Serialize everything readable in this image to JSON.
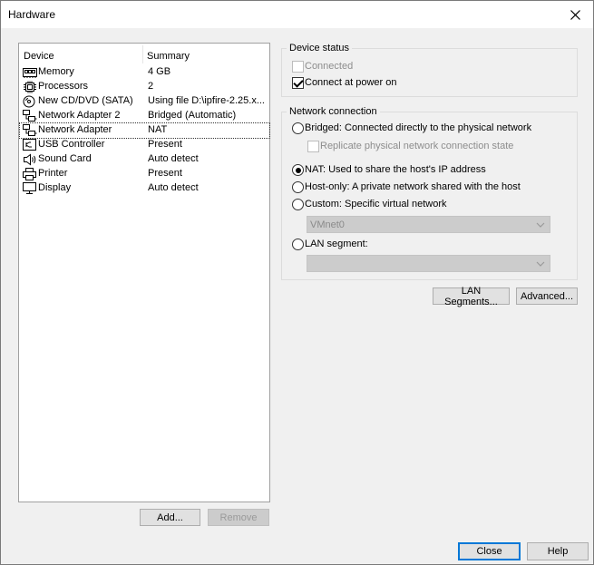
{
  "window": {
    "title": "Hardware"
  },
  "device_list": {
    "columns": [
      "Device",
      "Summary"
    ],
    "rows": [
      {
        "device": "Memory",
        "summary": "4 GB",
        "icon": "memory-icon"
      },
      {
        "device": "Processors",
        "summary": "2",
        "icon": "processor-icon"
      },
      {
        "device": "New CD/DVD (SATA)",
        "summary": "Using file D:\\ipfire-2.25.x...",
        "icon": "cd-dvd-icon"
      },
      {
        "device": "Network Adapter 2",
        "summary": "Bridged (Automatic)",
        "icon": "network-adapter-icon"
      },
      {
        "device": "Network Adapter",
        "summary": "NAT",
        "icon": "network-adapter-icon",
        "selected": true
      },
      {
        "device": "USB Controller",
        "summary": "Present",
        "icon": "usb-icon"
      },
      {
        "device": "Sound Card",
        "summary": "Auto detect",
        "icon": "speaker-icon"
      },
      {
        "device": "Printer",
        "summary": "Present",
        "icon": "printer-icon"
      },
      {
        "device": "Display",
        "summary": "Auto detect",
        "icon": "monitor-icon"
      }
    ],
    "add_label": "Add...",
    "remove_label": "Remove"
  },
  "device_status": {
    "title": "Device status",
    "connected_label": "Connected",
    "connected_checked": false,
    "connect_power_label": "Connect at power on",
    "connect_power_checked": true
  },
  "network_connection": {
    "title": "Network connection",
    "bridged_label": "Bridged: Connected directly to the physical network",
    "replicate_label": "Replicate physical network connection state",
    "nat_label": "NAT: Used to share the host's IP address",
    "hostonly_label": "Host-only: A private network shared with the host",
    "custom_label": "Custom: Specific virtual network",
    "custom_value": "VMnet0",
    "lan_label": "LAN segment:",
    "lan_value": "",
    "selected": "nat"
  },
  "buttons": {
    "lan_segments": "LAN Segments...",
    "advanced": "Advanced...",
    "close": "Close",
    "help": "Help"
  }
}
